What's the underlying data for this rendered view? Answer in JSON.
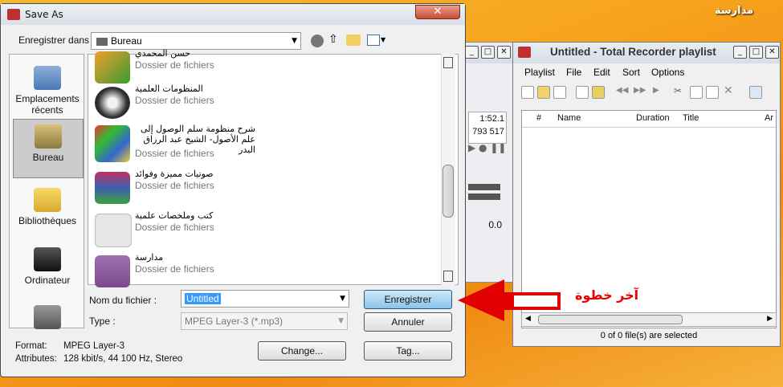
{
  "desktop": {
    "label": "مدارسة"
  },
  "playlist_window": {
    "title": "Untitled - Total Recorder playlist",
    "menu": [
      "Playlist",
      "File",
      "Edit",
      "Sort",
      "Options"
    ],
    "columns": [
      "#",
      "Name",
      "Duration",
      "Title",
      "Ar"
    ],
    "status": "0 of 0 file(s) are selected"
  },
  "player": {
    "time": "1:52.1",
    "count": "793 517",
    "level": "0.0"
  },
  "dialog": {
    "title": "Save As",
    "save_in_label": "Enregistrer dans :",
    "save_in_value": "Bureau",
    "places": [
      "Emplacements récents",
      "Bureau",
      "Bibliothèques",
      "Ordinateur"
    ],
    "files": [
      {
        "name": "حسن المحمدي",
        "type": "Dossier de fichiers",
        "icon": "msn-icon"
      },
      {
        "name": "المنظومات العلمية",
        "type": "Dossier de fichiers",
        "icon": "audio-cd-icon"
      },
      {
        "name": "شرح منظومة سلم الوصول إلى علم الأصول- الشيخ عبد الرزاق البدر",
        "type": "Dossier de fichiers",
        "icon": "windows-media-icon"
      },
      {
        "name": "صوتيات مميزة وفوائد",
        "type": "Dossier de fichiers",
        "icon": "winrar-icon"
      },
      {
        "name": "كتب وملخصات علمية",
        "type": "Dossier de fichiers",
        "icon": "folder-stack-icon"
      },
      {
        "name": "مدارسة",
        "type": "Dossier de fichiers",
        "icon": "floppy-icon"
      }
    ],
    "filename_label": "Nom du fichier :",
    "filename_value": "Untitled",
    "type_label": "Type :",
    "type_value": "MPEG Layer-3 (*.mp3)",
    "save_button": "Enregistrer",
    "cancel_button": "Annuler",
    "change_button": "Change...",
    "tag_button": "Tag...",
    "format_label": "Format:",
    "format_value": "MPEG Layer-3",
    "attributes_label": "Attributes:",
    "attributes_value": "128 kbit/s, 44 100 Hz, Stereo"
  },
  "annotation": {
    "text": "آخر خطوة",
    "color": "#e00000"
  }
}
